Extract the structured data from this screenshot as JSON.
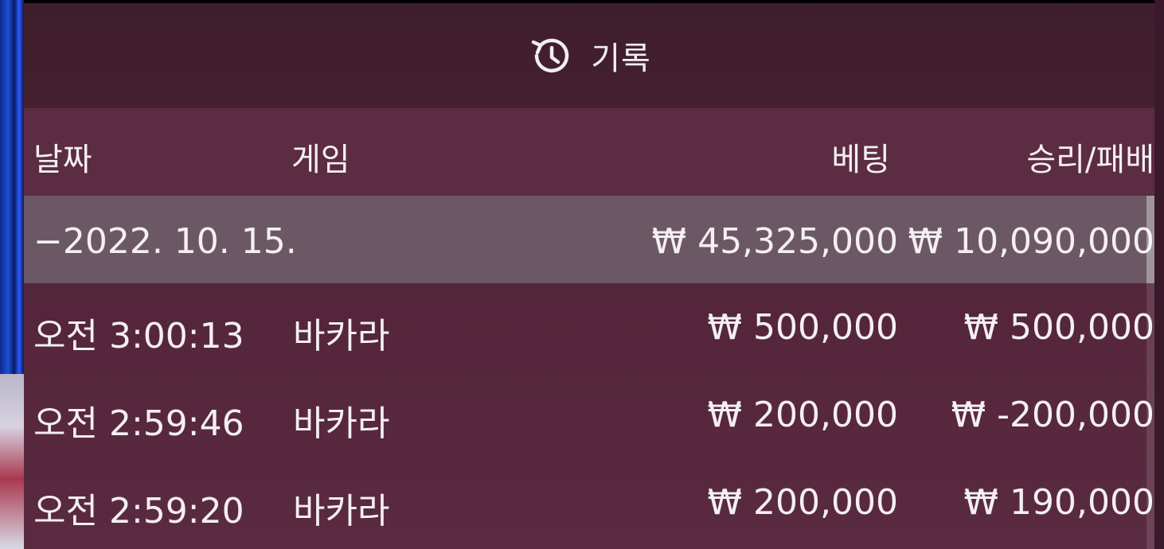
{
  "header": {
    "icon": "history-icon",
    "title": "기록"
  },
  "columns": {
    "date": "날짜",
    "game": "게임",
    "bet": "베팅",
    "win_loss": "승리/패배"
  },
  "summary": {
    "date": "−2022. 10. 15.",
    "bet": "₩ 45,325,000",
    "win_loss": "₩ 10,090,000"
  },
  "rows": [
    {
      "time": "오전 3:00:13",
      "game": "바카라",
      "bet": "₩ 500,000",
      "win_loss": "₩ 500,000"
    },
    {
      "time": "오전 2:59:46",
      "game": "바카라",
      "bet": "₩ 200,000",
      "win_loss": "₩ -200,000"
    },
    {
      "time": "오전 2:59:20",
      "game": "바카라",
      "bet": "₩ 200,000",
      "win_loss": "₩ 190,000"
    }
  ],
  "colors": {
    "panel": "#532539",
    "header_bg": "#3e1d2e",
    "column_header_bg": "#5c2c42",
    "summary_row_bg": "#6c5864",
    "text": "#f4eff2"
  }
}
